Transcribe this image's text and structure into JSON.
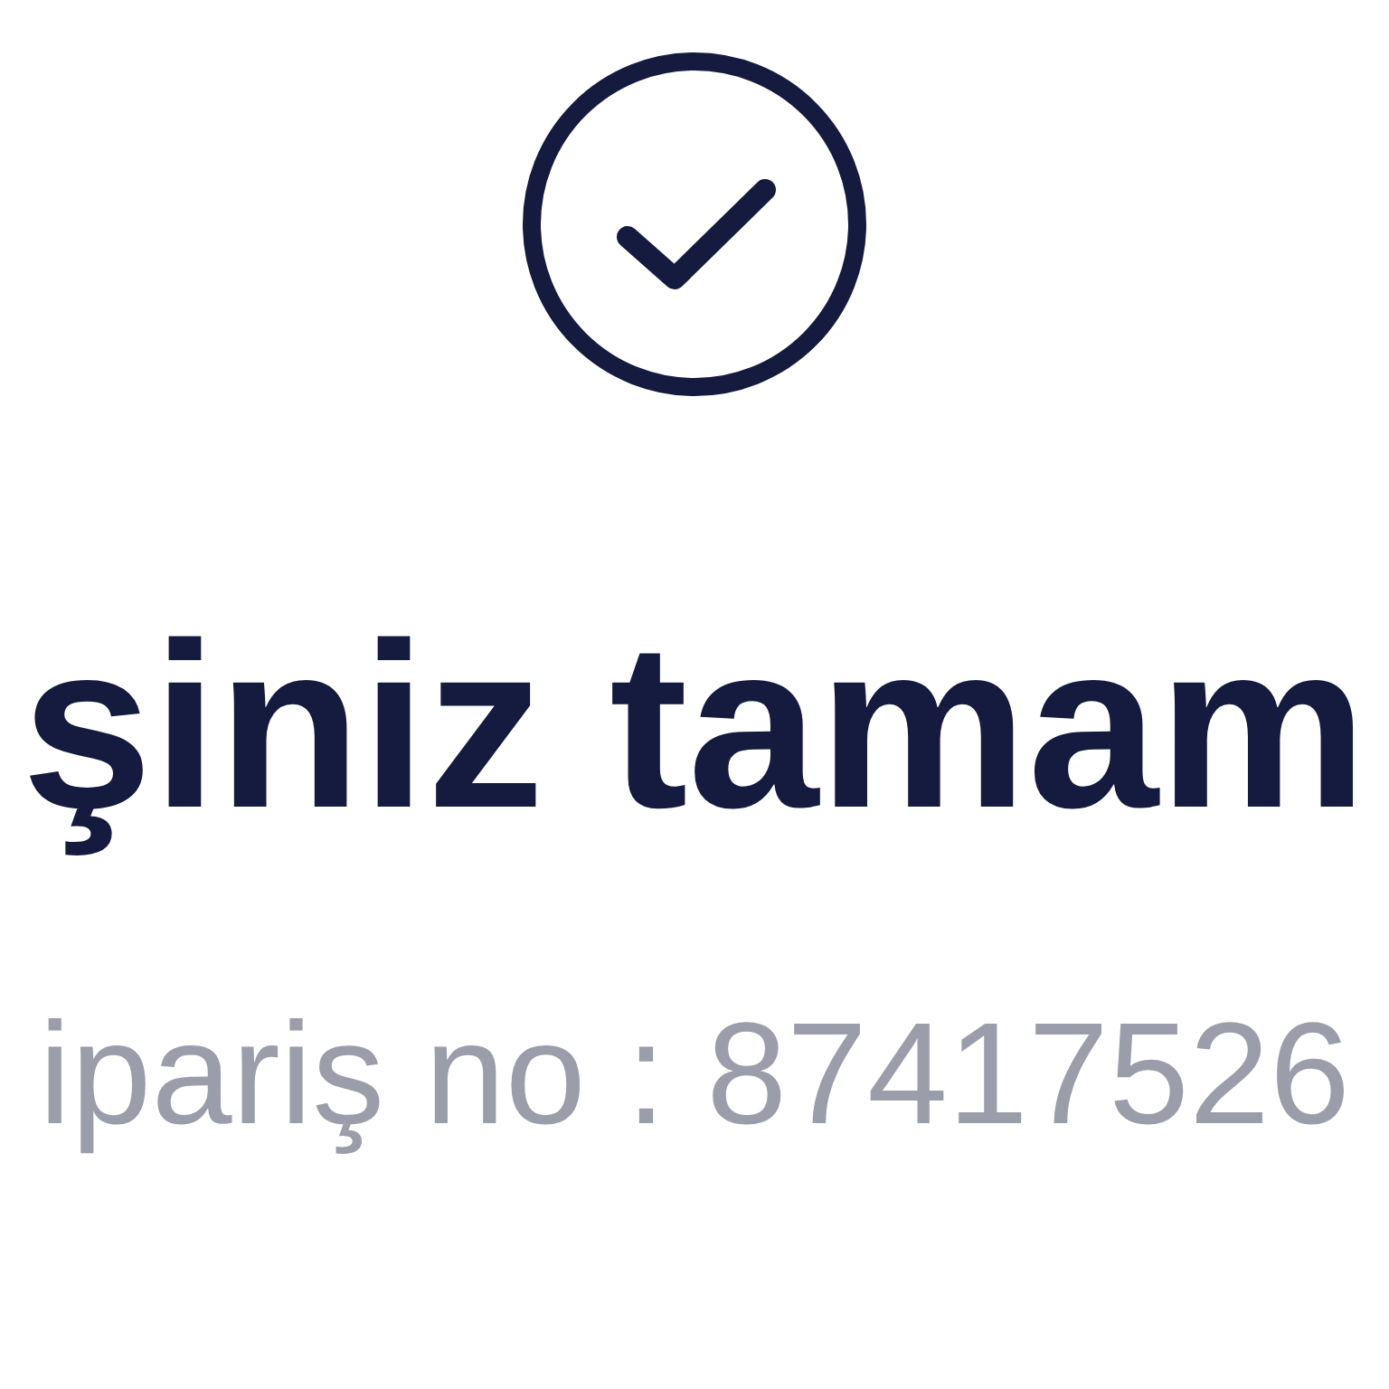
{
  "heading": "şiniz tamam",
  "order_line": "ipariş no : 87417526"
}
